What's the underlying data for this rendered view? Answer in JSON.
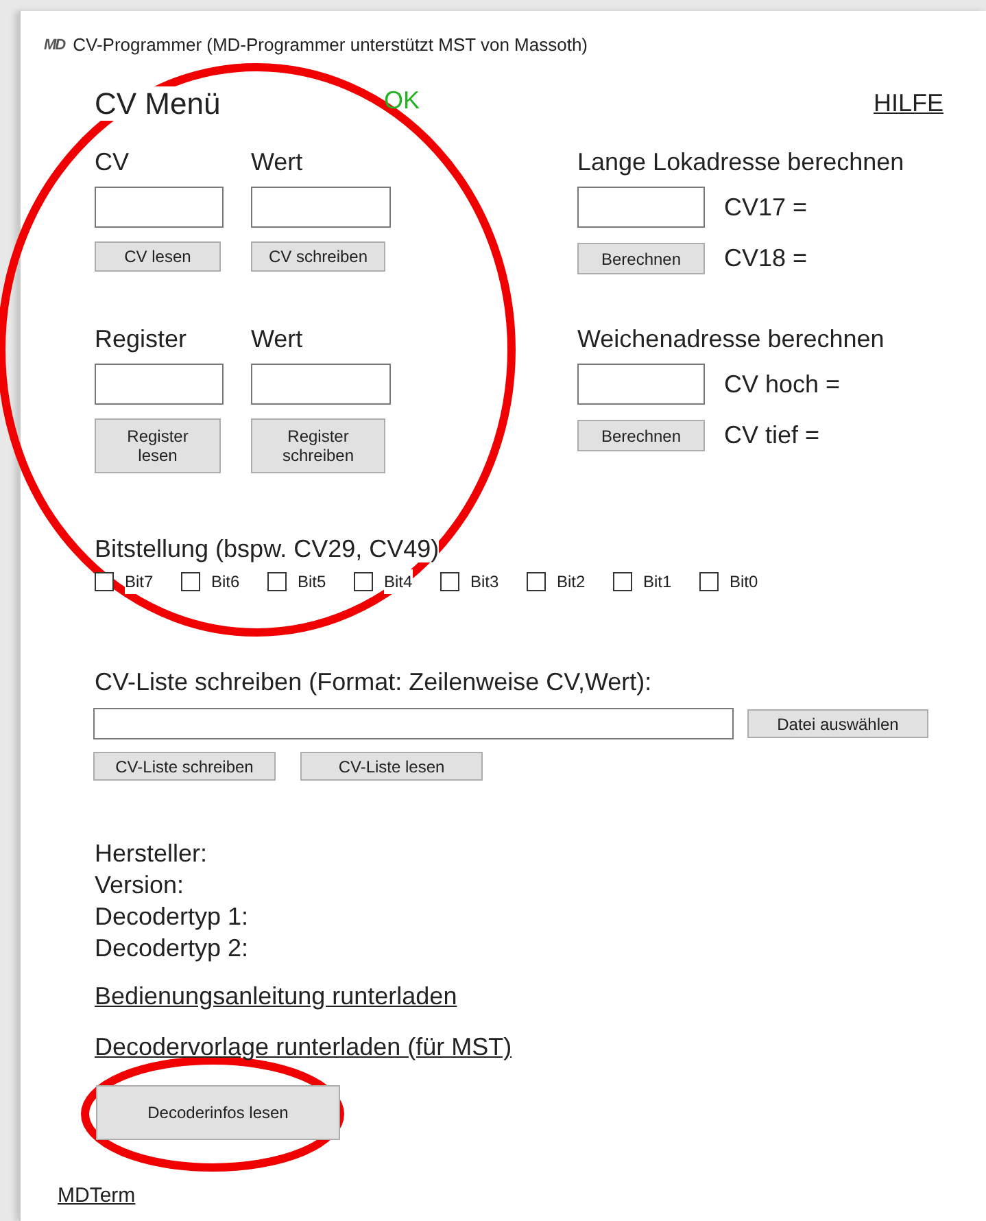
{
  "window": {
    "icon_text": "MD",
    "title": "CV-Programmer (MD-Programmer unterstützt MST von Massoth)"
  },
  "header": {
    "title": "CV Menü",
    "status": "OK",
    "help_link": "HILFE"
  },
  "cv_panel": {
    "fields": [
      {
        "label": "CV",
        "button": "CV lesen"
      },
      {
        "label": "Wert",
        "button": "CV schreiben"
      }
    ]
  },
  "long_address": {
    "title": "Lange Lokadresse berechnen",
    "results": [
      "CV17 =",
      "CV18 ="
    ],
    "button": "Berechnen"
  },
  "register_panel": {
    "fields": [
      {
        "label": "Register",
        "button": "Register lesen"
      },
      {
        "label": "Wert",
        "button": "Register schreiben"
      }
    ]
  },
  "switch_address": {
    "title": "Weichenadresse berechnen",
    "results": [
      "CV hoch =",
      "CV tief ="
    ],
    "button": "Berechnen"
  },
  "bits": {
    "title": "Bitstellung (bspw. CV29, CV49)",
    "items": [
      {
        "label": "Bit7",
        "checked": false
      },
      {
        "label": "Bit6",
        "checked": false
      },
      {
        "label": "Bit5",
        "checked": false
      },
      {
        "label": "Bit4",
        "checked": false
      },
      {
        "label": "Bit3",
        "checked": false
      },
      {
        "label": "Bit2",
        "checked": false
      },
      {
        "label": "Bit1",
        "checked": false
      },
      {
        "label": "Bit0",
        "checked": false
      }
    ]
  },
  "cv_list": {
    "title": "CV-Liste schreiben (Format: Zeilenweise CV,Wert):",
    "file_button": "Datei auswählen",
    "buttons": [
      "CV-Liste schreiben",
      "CV-Liste lesen"
    ]
  },
  "decoder_info": {
    "lines": [
      "Hersteller:",
      "Version:",
      "Decodertyp 1:",
      "Decodertyp 2:"
    ],
    "links": [
      "Bedienungsanleitung runterladen",
      "Decodervorlage runterladen (für MST)"
    ],
    "button": "Decoderinfos lesen"
  },
  "footer_link": "MDTerm",
  "annotations": [
    {
      "kind": "ellipse"
    },
    {
      "kind": "ellipse"
    }
  ]
}
